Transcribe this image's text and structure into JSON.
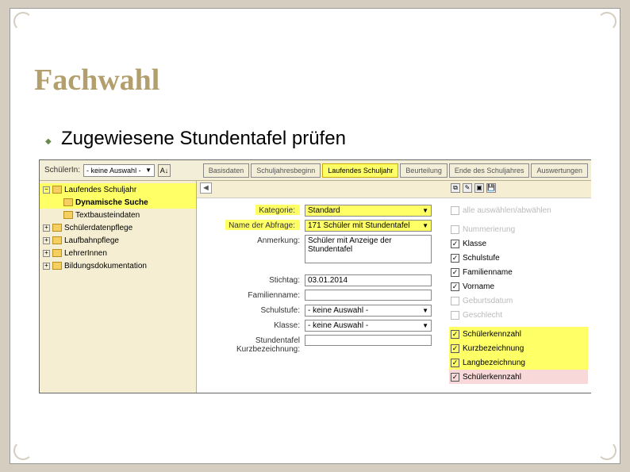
{
  "title": "Fachwahl",
  "subtitle": "Zugewiesene Stundentafel prüfen",
  "topbar": {
    "schuelerLabel": "SchülerIn:",
    "schuelerValue": "- keine Auswahl -"
  },
  "tabs": {
    "basisdaten": "Basisdaten",
    "schuljahresbeginn": "Schuljahresbeginn",
    "laufendes": "Laufendes Schuljahr",
    "beurteilung": "Beurteilung",
    "ende": "Ende des Schuljahres",
    "auswertungen": "Auswertungen"
  },
  "tree": {
    "laufendes": "Laufendes Schuljahr",
    "dynamische": "Dynamische Suche",
    "textbaustein": "Textbausteindaten",
    "schuelerdaten": "Schülerdatenpflege",
    "laufbahn": "Laufbahnpflege",
    "lehrer": "LehrerInnen",
    "bildung": "Bildungsdokumentation"
  },
  "form": {
    "kategorieLabel": "Kategorie:",
    "kategorieValue": "Standard",
    "abfrageLabel": "Name der Abfrage:",
    "abfrageValue": "171 Schüler mit Stundentafel",
    "anmerkungLabel": "Anmerkung:",
    "anmerkungValue": "Schüler mit Anzeige der Stundentafel",
    "stichtagLabel": "Stichtag:",
    "stichtagValue": "03.01.2014",
    "familiennameLabel": "Familienname:",
    "familiennameValue": "",
    "schulstufeLabel": "Schulstufe:",
    "schulstufeValue": "- keine Auswahl -",
    "klasseLabel": "Klasse:",
    "klasseValue": "- keine Auswahl -",
    "kurzLabel": "Stundentafel Kurzbezeichnung:",
    "kurzValue": ""
  },
  "checks": {
    "alle": "alle auswählen/abwählen",
    "nummerierung": "Nummerierung",
    "klasse": "Klasse",
    "schulstufe": "Schulstufe",
    "familienname": "Familienname",
    "vorname": "Vorname",
    "geburtsdatum": "Geburtsdatum",
    "geschlecht": "Geschlecht",
    "schuelerkennzahl": "Schülerkennzahl",
    "kurzbezeichnung": "Kurzbezeichnung",
    "langbezeichnung": "Langbezeichnung",
    "schuelerkennzahl2": "Schülerkennzahl"
  }
}
